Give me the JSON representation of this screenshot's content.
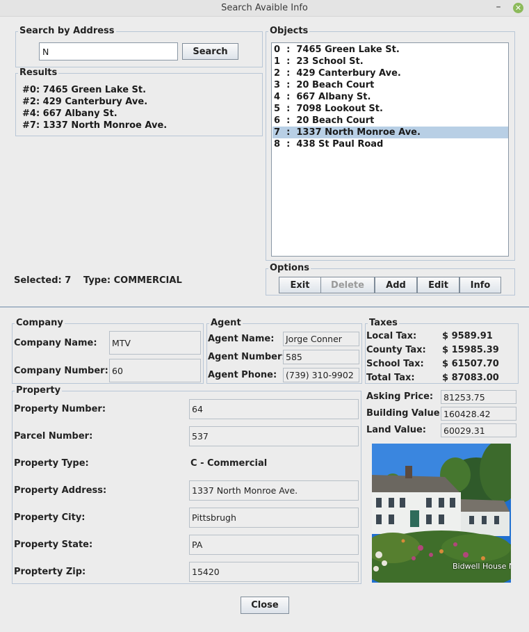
{
  "window": {
    "title": "Search Avaible Info"
  },
  "search": {
    "legend": "Search by Address",
    "query": "N",
    "button": "Search"
  },
  "results": {
    "legend": "Results",
    "items": [
      "#0: 7465 Green Lake St.",
      "#2: 429 Canterbury Ave.",
      "#4: 667 Albany St.",
      "#7: 1337 North Monroe Ave."
    ]
  },
  "objects": {
    "legend": "Objects",
    "items": [
      {
        "index": "0",
        "address": "7465 Green Lake St."
      },
      {
        "index": "1",
        "address": "23 School St."
      },
      {
        "index": "2",
        "address": "429 Canterbury Ave."
      },
      {
        "index": "3",
        "address": "20 Beach Court"
      },
      {
        "index": "4",
        "address": "667 Albany St."
      },
      {
        "index": "5",
        "address": "7098 Lookout St."
      },
      {
        "index": "6",
        "address": "20 Beach Court"
      },
      {
        "index": "7",
        "address": "1337 North Monroe Ave."
      },
      {
        "index": "8",
        "address": "438 St Paul Road"
      }
    ],
    "selected_index": 7
  },
  "selection": {
    "selected_label": "Selected: 7",
    "type_label": "Type: COMMERCIAL"
  },
  "options": {
    "legend": "Options",
    "buttons": {
      "exit": "Exit",
      "delete": "Delete",
      "add": "Add",
      "edit": "Edit",
      "info": "Info"
    }
  },
  "company": {
    "legend": "Company",
    "name_label": "Company Name:",
    "name": "MTV",
    "number_label": "Company Number:",
    "number": "60"
  },
  "agent": {
    "legend": "Agent",
    "name_label": "Agent Name:",
    "name": "Jorge Conner",
    "number_label": "Agent Number:",
    "number": "585",
    "phone_label": "Agent Phone:",
    "phone": "(739) 310-9902"
  },
  "taxes": {
    "legend": "Taxes",
    "local_label": "Local Tax:",
    "local": "$ 9589.91",
    "county_label": "County Tax:",
    "county": "$ 15985.39",
    "school_label": "School Tax:",
    "school": "$ 61507.70",
    "total_label": "Total Tax:",
    "total": "$ 87083.00"
  },
  "pricing": {
    "asking_label": "Asking Price:",
    "asking": "81253.75",
    "building_label": "Building Value:",
    "building": "160428.42",
    "land_label": "Land Value:",
    "land": "60029.31"
  },
  "property": {
    "legend": "Property",
    "number_label": "Property Number:",
    "number": "64",
    "parcel_label": "Parcel Number:",
    "parcel": "537",
    "type_label": "Property Type:",
    "type": "C - Commercial",
    "address_label": "Property Address:",
    "address": "1337 North Monroe Ave.",
    "city_label": "Property City:",
    "city": "Pittsbrugh",
    "state_label": "Property State:",
    "state": "PA",
    "zip_label": "Propterty Zip:",
    "zip": "15420"
  },
  "photo": {
    "caption": "Bidwell House N"
  },
  "footer": {
    "close": "Close"
  },
  "colors": {
    "selection": "#b8cfe5",
    "border": "#b8c6d6",
    "separator": "#6d8aa8"
  }
}
